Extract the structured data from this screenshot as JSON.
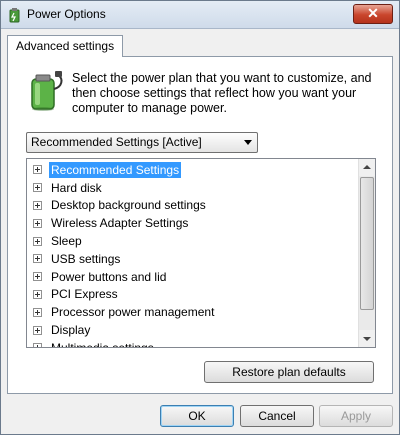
{
  "window": {
    "title": "Power Options",
    "close_glyph": "✕"
  },
  "tab": {
    "label": "Advanced settings"
  },
  "description": "Select the power plan that you want to customize, and then choose settings that reflect how you want your computer to manage power.",
  "plan_select": {
    "value": "Recommended Settings [Active]"
  },
  "settings_tree": {
    "items": [
      {
        "label": "Recommended Settings",
        "selected": true
      },
      {
        "label": "Hard disk"
      },
      {
        "label": "Desktop background settings"
      },
      {
        "label": "Wireless Adapter Settings"
      },
      {
        "label": "Sleep"
      },
      {
        "label": "USB settings"
      },
      {
        "label": "Power buttons and lid"
      },
      {
        "label": "PCI Express"
      },
      {
        "label": "Processor power management"
      },
      {
        "label": "Display"
      },
      {
        "label": "Multimedia settings"
      }
    ]
  },
  "buttons": {
    "restore": "Restore plan defaults",
    "ok": "OK",
    "cancel": "Cancel",
    "apply": "Apply"
  },
  "icons": {
    "title": "power-options-icon",
    "plan": "battery-plug-icon"
  },
  "colors": {
    "selection": "#3399ff",
    "close_button": "#c9452c"
  }
}
